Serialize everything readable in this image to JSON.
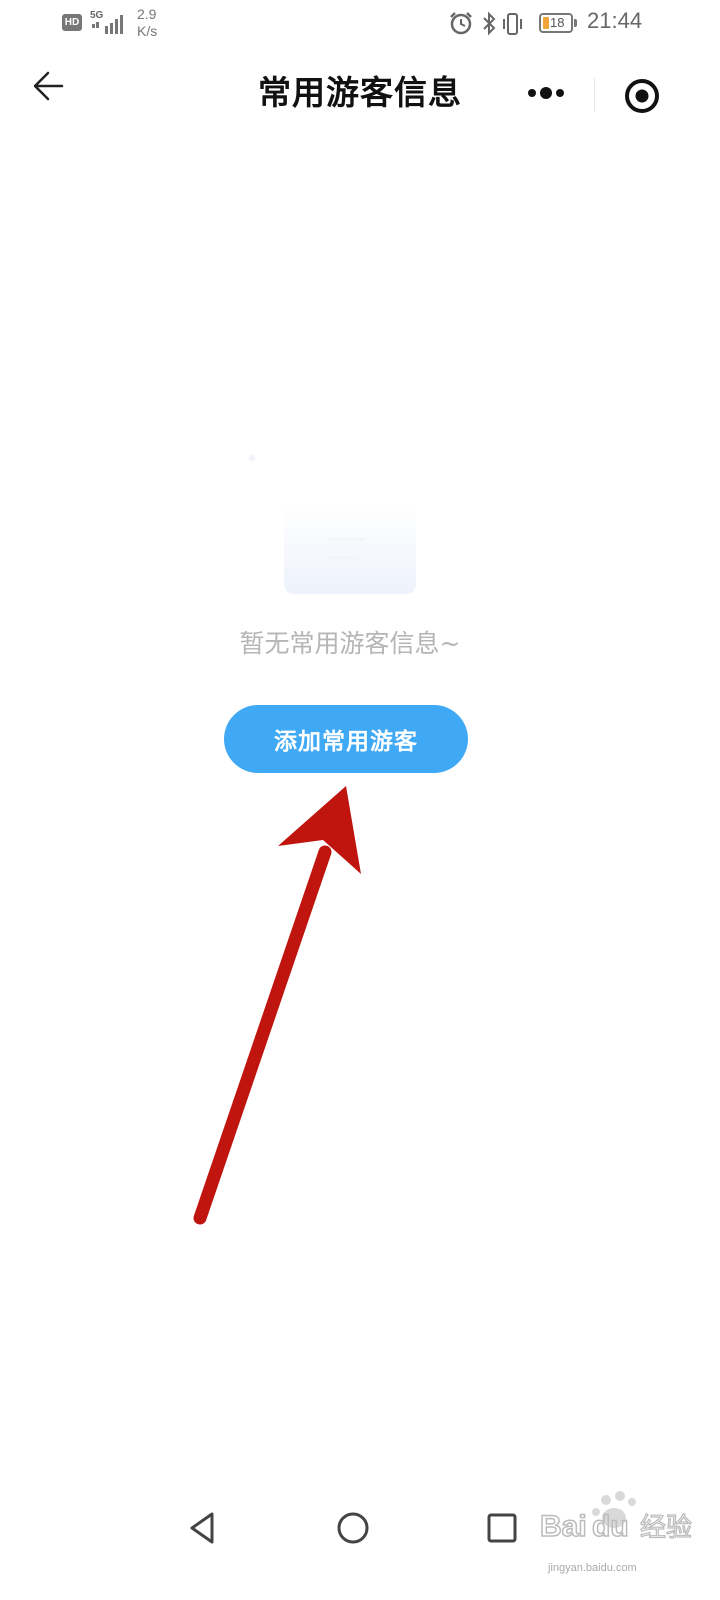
{
  "status_bar": {
    "hd_badge": "HD",
    "network_type": "5G",
    "speed_value": "2.9",
    "speed_unit": "K/s",
    "battery_level": "18",
    "time": "21:44",
    "icons": [
      "alarm-icon",
      "bluetooth-icon",
      "vibrate-icon",
      "battery-icon"
    ]
  },
  "header": {
    "title": "常用游客信息",
    "back_icon": "arrow-left-icon",
    "more_icon": "more-dots-icon",
    "close_icon": "target-close-icon"
  },
  "empty_state": {
    "illustration": "empty-folder-illustration",
    "message": "暂无常用游客信息~",
    "button_label": "添加常用游客",
    "button_color": "#40a9f5"
  },
  "annotation": {
    "color": "#c0150f"
  },
  "system_nav": {
    "back_icon": "triangle-back-icon",
    "home_icon": "circle-home-icon",
    "recents_icon": "square-recents-icon"
  },
  "watermark": {
    "logo": "Baidu经验",
    "url": "jingyan.baidu.com"
  }
}
